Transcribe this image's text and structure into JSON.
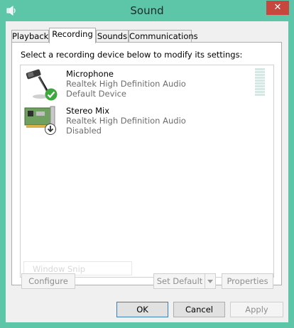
{
  "window": {
    "title": "Sound",
    "close_glyph": "✕",
    "icon": "speaker-icon"
  },
  "tabs": [
    {
      "label": "Playback",
      "active": false
    },
    {
      "label": "Recording",
      "active": true
    },
    {
      "label": "Sounds",
      "active": false
    },
    {
      "label": "Communications",
      "active": false
    }
  ],
  "panel": {
    "instruction": "Select a recording device below to modify its settings:"
  },
  "devices": [
    {
      "name": "Microphone",
      "driver": "Realtek High Definition Audio",
      "status": "Default Device",
      "icon": "microphone-icon",
      "badge": "default-check-icon",
      "level_meter_fraction": 0
    },
    {
      "name": "Stereo Mix",
      "driver": "Realtek High Definition Audio",
      "status": "Disabled",
      "icon": "sound-card-icon",
      "badge": "disabled-arrow-icon"
    }
  ],
  "overlay": {
    "ghost_label": "Window Snip"
  },
  "panel_buttons": {
    "configure": "Configure",
    "set_default": "Set Default",
    "properties": "Properties"
  },
  "dialog_buttons": {
    "ok": "OK",
    "cancel": "Cancel",
    "apply": "Apply"
  },
  "colors": {
    "frame": "#5ec6a8",
    "close": "#c7463e",
    "check": "#3da83d"
  }
}
